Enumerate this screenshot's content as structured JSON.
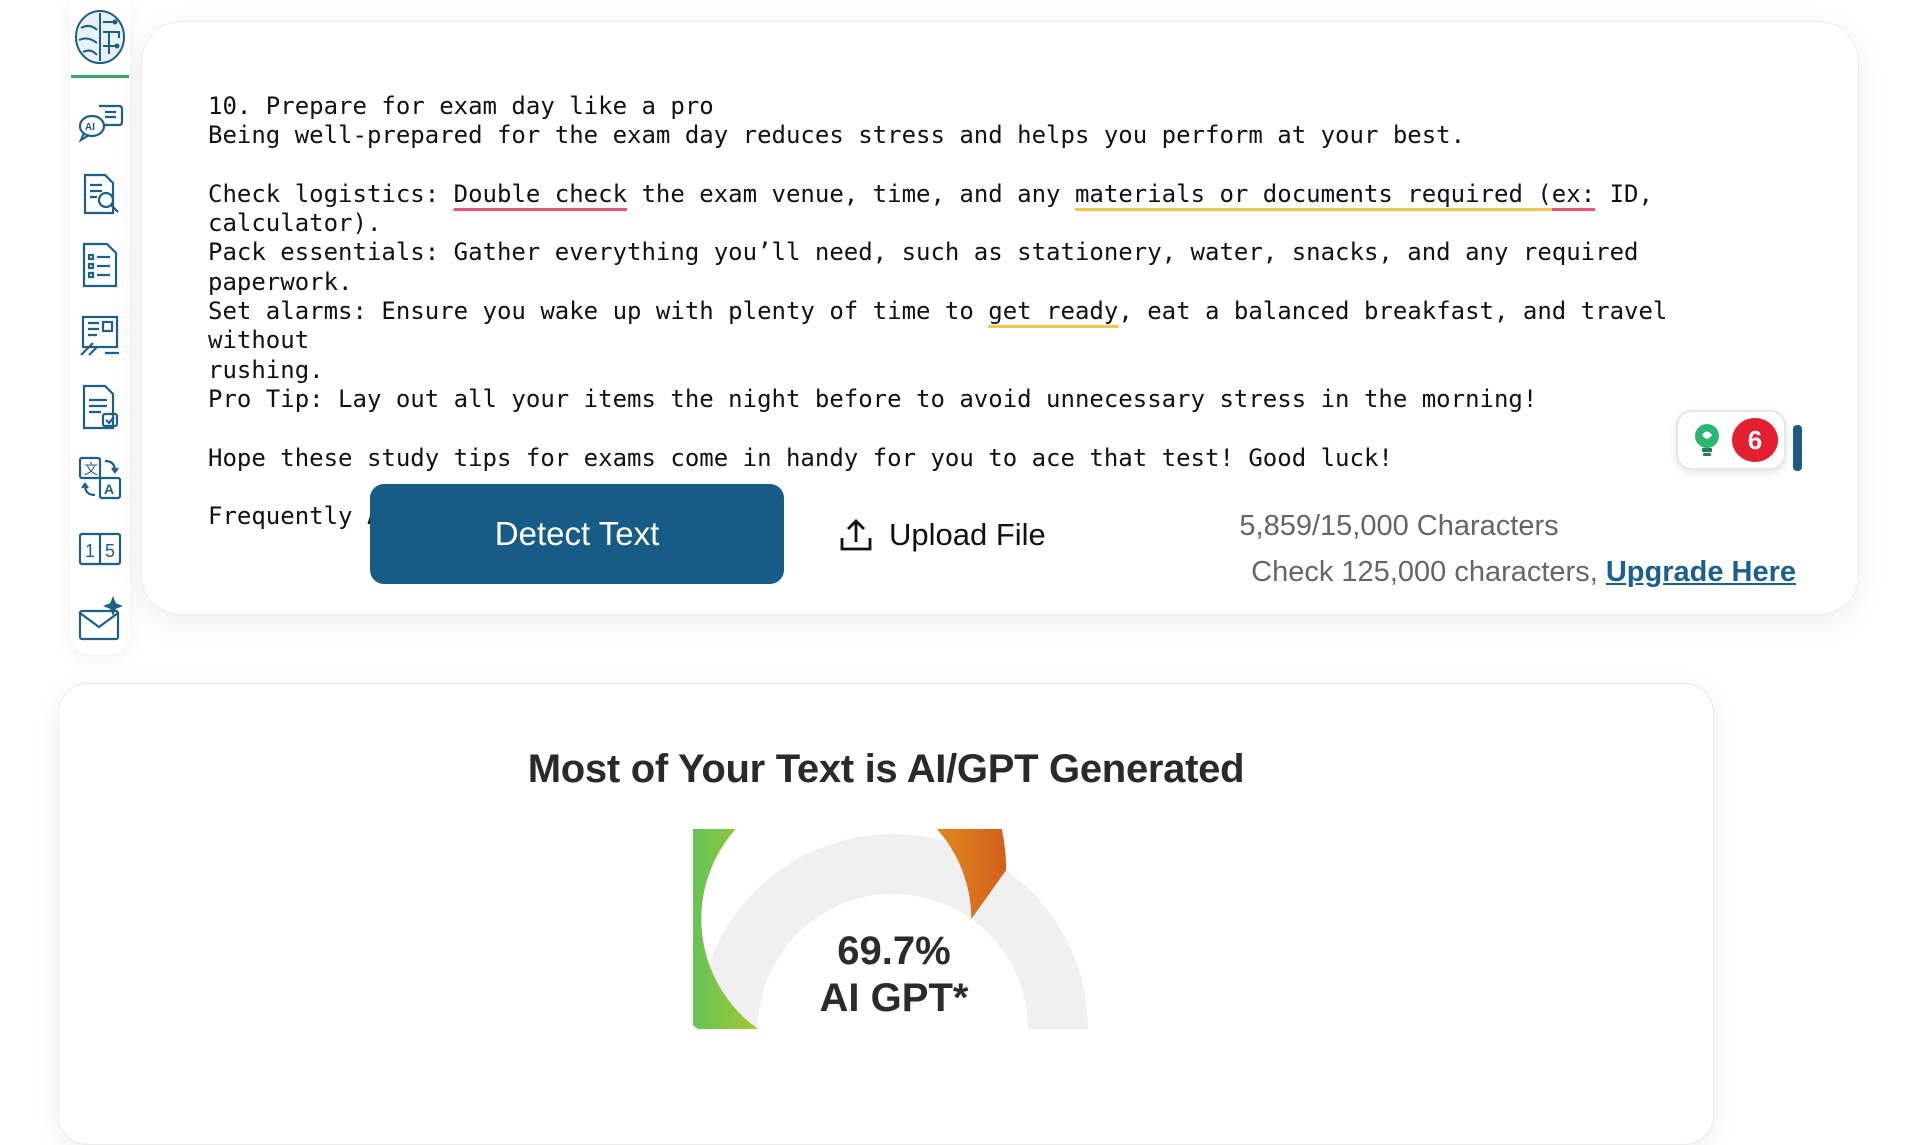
{
  "editor": {
    "lines": [
      "10. Prepare for exam day like a pro",
      "Being well-prepared for the exam day reduces stress and helps you perform at your best.",
      "",
      "Check logistics: ",
      "Double check",
      " the exam venue, time, and any ",
      "materials or documents required (",
      "ex:",
      " ID,",
      "calculator).",
      "Pack essentials: Gather everything you’ll need, such as stationery, water, snacks, and any required paperwork.",
      "Set alarms: Ensure you wake up with plenty of time to ",
      "get ready",
      ", eat a balanced breakfast, and travel without",
      "rushing.",
      "Pro Tip: Lay out all your items the night before to avoid unnecessary stress in the morning!",
      "",
      "Hope these study tips for exams come in handy for you to ace that test! Good luck!",
      "",
      "Frequently Asked Questions"
    ]
  },
  "widget": {
    "badge_count": "6",
    "icon": "grammar-bulb-icon"
  },
  "actions": {
    "detect_label": "Detect Text",
    "upload_label": "Upload File"
  },
  "limits": {
    "count_text": "5,859/15,000 Characters",
    "upgrade_prefix": "Check 125,000 characters, ",
    "upgrade_link": "Upgrade Here"
  },
  "result": {
    "title": "Most of Your Text is AI/GPT Generated",
    "percent_text": "69.7%",
    "label": "AI GPT*",
    "ai_fraction": 0.697
  },
  "sidebar": {
    "items": [
      "brain-logo-icon",
      "ai-chat-icon",
      "document-search-icon",
      "document-list-icon",
      "content-tools-icon",
      "document-check-icon",
      "translate-icon",
      "number-compare-icon",
      "mail-sparkle-icon"
    ]
  },
  "colors": {
    "primary": "#175c86",
    "badge": "#e3202f",
    "accent_green": "#38a865"
  }
}
